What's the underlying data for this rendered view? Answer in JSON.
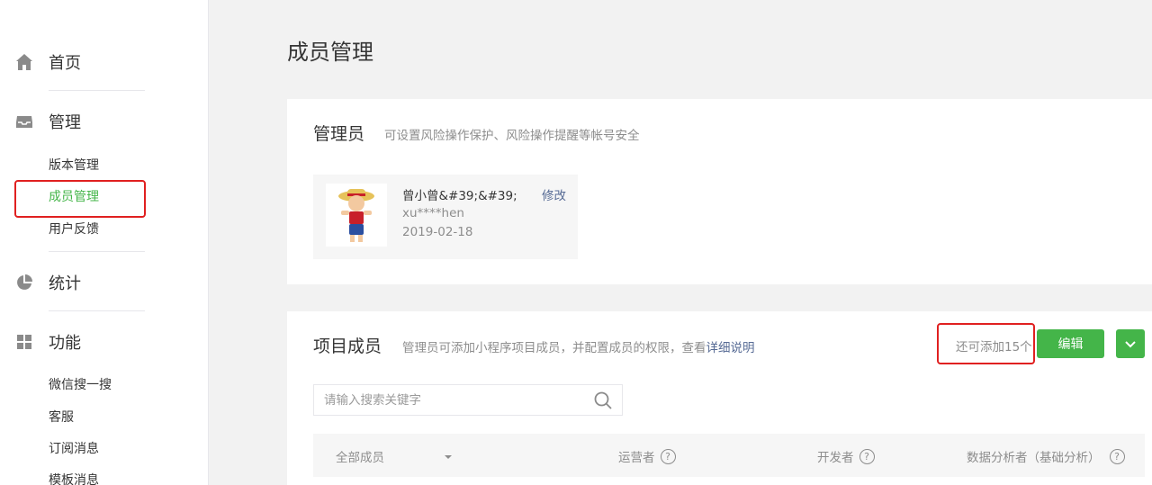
{
  "sidebar": {
    "groups": [
      {
        "label": "首页",
        "icon": "home-icon"
      },
      {
        "label": "管理",
        "icon": "inbox-icon"
      },
      {
        "label": "统计",
        "icon": "pie-chart-icon"
      },
      {
        "label": "功能",
        "icon": "grid-icon"
      }
    ],
    "manage_items": [
      "版本管理",
      "成员管理",
      "用户反馈"
    ],
    "feature_items": [
      "微信搜一搜",
      "客服",
      "订阅消息",
      "模板消息"
    ]
  },
  "page": {
    "title": "成员管理"
  },
  "admin": {
    "heading": "管理员",
    "description": "可设置风险操作保护、风险操作提醒等帐号安全",
    "name": "曾小曾&#39;&#39;",
    "edit_label": "修改",
    "account": "xu****hen",
    "date": "2019-02-18"
  },
  "members": {
    "heading": "项目成员",
    "description": "管理员可添加小程序项目成员，并配置成员的权限，查看",
    "detail_link": "详细说明",
    "remaining": "还可添加15个",
    "edit_button": "编辑",
    "search_placeholder": "请输入搜索关键字",
    "columns": {
      "all": "全部成员",
      "operator": "运营者",
      "developer": "开发者",
      "analyst": "数据分析者（基础分析）"
    }
  },
  "colors": {
    "accent": "#44b549",
    "link": "#576b95",
    "highlight": "#e02020"
  }
}
